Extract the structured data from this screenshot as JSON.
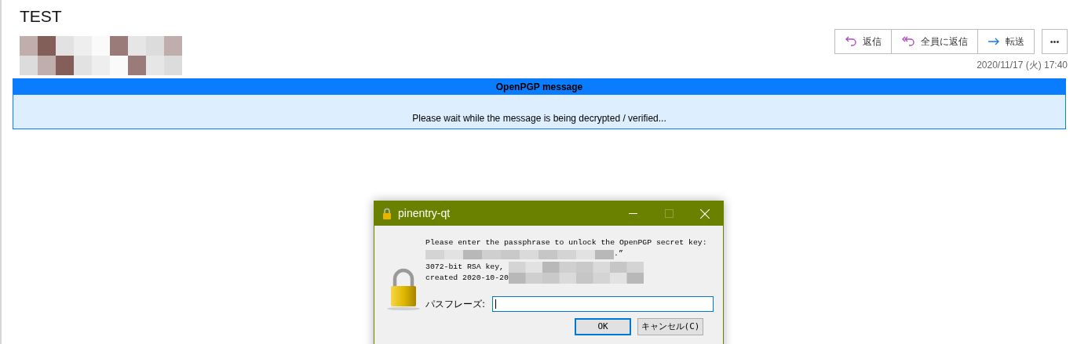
{
  "message": {
    "subject": "TEST",
    "actions": [
      {
        "kind": "reply",
        "label": "返信"
      },
      {
        "kind": "reply_all",
        "label": "全員に返信"
      },
      {
        "kind": "forward",
        "label": "転送"
      },
      {
        "kind": "more",
        "label": "•••"
      }
    ],
    "date": "2020/11/17 (火) 17:40"
  },
  "openpgp": {
    "title": "OpenPGP message",
    "status": "Please wait while the message is being decrypted / verified..."
  },
  "dialog": {
    "title": "pinentry-qt",
    "window_controls": [
      {
        "kind": "minimize",
        "disabled": false
      },
      {
        "kind": "maximize",
        "disabled": true
      },
      {
        "kind": "close",
        "disabled": false
      }
    ],
    "prompt": "Please enter the passphrase to unlock the OpenPGP secret key:",
    "key_line_end": ".”",
    "key_type": "3072-bit RSA key,",
    "created": "created 2020-10-20",
    "passphrase_label": "パスフレーズ:",
    "buttons": [
      {
        "label": "OK",
        "default": true
      },
      {
        "label": "キャンセル(C)",
        "default": false
      }
    ]
  }
}
